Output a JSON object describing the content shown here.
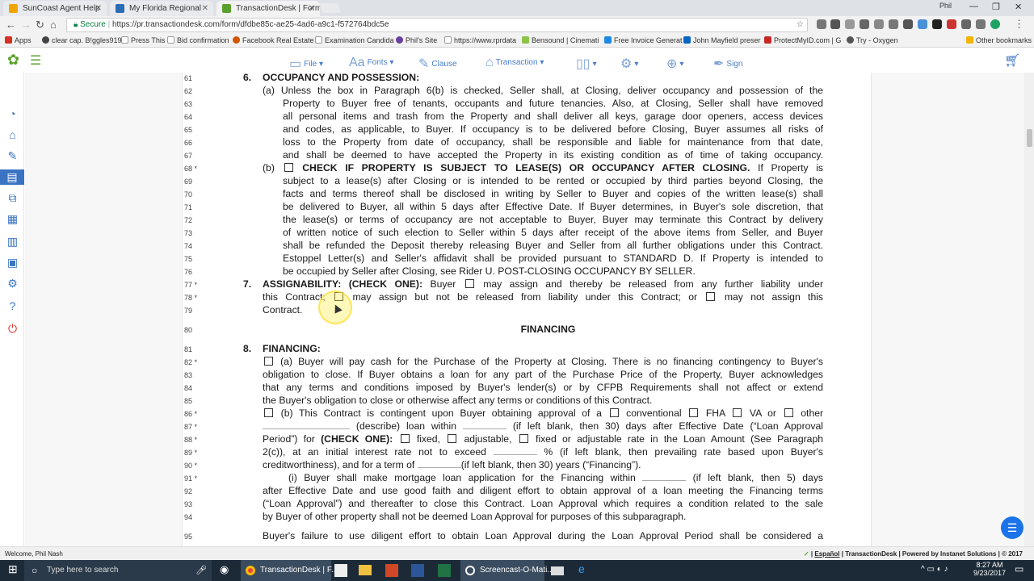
{
  "browser": {
    "tabs": [
      {
        "title": "SunCoast Agent Help"
      },
      {
        "title": "My Florida Regional"
      },
      {
        "title": "TransactionDesk | Forms"
      }
    ],
    "secure_label": "Secure",
    "url": "https://pr.transactiondesk.com/form/dfdbe85c-ae25-4ad6-a9c1-f572764bdc5e",
    "user_badge": "Phil",
    "bookmarks": [
      "Apps",
      "clear cap. B!ggles919",
      "Press This",
      "Bid confirmation",
      "Facebook Real Estate",
      "Examination Candida",
      "Phil's Site",
      "https://www.rprdata",
      "Bensound | Cinemati",
      "Free Invoice Generat",
      "John Mayfield preser",
      "ProtectMyID.com | G",
      "Try - Oxygen",
      "Other bookmarks"
    ]
  },
  "toolbar": {
    "file": "File",
    "fonts": "Fonts",
    "clause": "Clause",
    "transaction": "Transaction",
    "sign": "Sign"
  },
  "document": {
    "lines": {
      "l61": {
        "num": "61",
        "text": "OCCUPANCY AND POSSESSION:"
      },
      "l62": {
        "num": "62",
        "text": "(a)  Unless the box in Paragraph 6(b) is checked, Seller shall, at Closing, deliver occupancy and possession of the"
      },
      "l63": {
        "num": "63",
        "text": "Property to Buyer free of tenants, occupants and future tenancies. Also, at Closing, Seller shall have removed"
      },
      "l64": {
        "num": "64",
        "text": "all personal items and trash from the Property and shall deliver all keys, garage door openers, access devices"
      },
      "l65": {
        "num": "65",
        "text": "and codes, as applicable, to Buyer. If occupancy is to be delivered before Closing, Buyer assumes all risks of"
      },
      "l66": {
        "num": "66",
        "text": "loss to the Property from date of occupancy, shall be responsible and liable for maintenance from that date,"
      },
      "l67": {
        "num": "67",
        "text": "and shall be deemed to have accepted the Property in its existing condition as of time of taking occupancy."
      },
      "l68": {
        "num": "68 *",
        "pre": "(b)",
        "bold": "CHECK IF PROPERTY IS SUBJECT TO LEASE(S) OR OCCUPANCY AFTER CLOSING.",
        "post": "If Property is"
      },
      "l69": {
        "num": "69",
        "text": "subject to a lease(s) after Closing or is intended to be rented or occupied by third parties beyond Closing, the"
      },
      "l70": {
        "num": "70",
        "text": "facts and terms thereof shall be disclosed in writing by Seller to Buyer and copies of the written lease(s) shall"
      },
      "l71": {
        "num": "71",
        "text": "be delivered to Buyer, all within 5 days after Effective Date. If Buyer determines, in Buyer's sole discretion, that"
      },
      "l72": {
        "num": "72",
        "text": "the lease(s) or terms of occupancy are not acceptable to Buyer, Buyer may terminate this Contract by delivery"
      },
      "l73": {
        "num": "73",
        "text": "of written notice of such election to Seller within 5 days after receipt of the above items from Seller, and Buyer"
      },
      "l74": {
        "num": "74",
        "text": "shall be refunded the Deposit thereby releasing Buyer and Seller from all further obligations under this Contract."
      },
      "l75": {
        "num": "75",
        "text": "Estoppel Letter(s) and Seller's affidavit shall be provided pursuant to STANDARD D. If Property is intended to"
      },
      "l76": {
        "num": "76",
        "text": "be occupied by Seller after Closing, see Rider U. POST-CLOSING OCCUPANCY BY SELLER."
      },
      "l77": {
        "num": "77 *",
        "bold": "ASSIGNABILITY: (CHECK ONE):",
        "a": "Buyer",
        "b": "may assign and thereby be released from any further liability under"
      },
      "l78": {
        "num": "78 *",
        "a": "this Contract;",
        "b": "may assign but not be released from liability under this Contract; or",
        "c": "may not assign this"
      },
      "l79": {
        "num": "79",
        "text": "Contract."
      },
      "l80": {
        "num": "80",
        "text": "FINANCING"
      },
      "l81": {
        "num": "81",
        "text": "FINANCING:"
      },
      "l82": {
        "num": "82 *",
        "text": "(a) Buyer will pay cash for the Purchase of the Property at Closing. There is no financing contingency to Buyer's"
      },
      "l83": {
        "num": "83",
        "text": "obligation to close. If Buyer obtains a loan for any part of the Purchase Price of the Property, Buyer acknowledges"
      },
      "l84": {
        "num": "84",
        "text": "that any terms and conditions imposed by Buyer's lender(s) or by CFPB Requirements shall not affect or extend"
      },
      "l85": {
        "num": "85",
        "text": "the Buyer's obligation to close or otherwise affect any terms or conditions of this Contract."
      },
      "l86": {
        "num": "86 *",
        "a": "(b) This Contract is contingent upon Buyer obtaining approval of a",
        "b": "conventional",
        "c": "FHA",
        "d": "VA or",
        "e": "other"
      },
      "l87": {
        "num": "87 *",
        "a": "(describe) loan within",
        "b": "(if left blank, then 30) days after Effective Date (“Loan Approval"
      },
      "l88": {
        "num": "88 *",
        "a": "Period”) for",
        "bold": "(CHECK ONE):",
        "b": "fixed,",
        "c": "adjustable,",
        "d": "fixed or adjustable rate in the Loan Amount (See Paragraph"
      },
      "l89": {
        "num": "89 *",
        "a": "2(c)), at an initial interest rate not to exceed",
        "b": "% (if left blank, then prevailing rate based upon Buyer's"
      },
      "l90": {
        "num": "90 *",
        "a": "creditworthiness), and for a term of",
        "b": "(if left blank, then 30) years (“Financing”)."
      },
      "l91": {
        "num": "91 *",
        "a": "(i) Buyer shall make mortgage loan application for the Financing within",
        "b": "(if left blank, then 5) days"
      },
      "l92": {
        "num": "92",
        "text": "after Effective Date and use good faith and diligent effort to obtain approval of a loan meeting the Financing terms"
      },
      "l93": {
        "num": "93",
        "text": "(“Loan Approval”) and thereafter to close this Contract. Loan Approval which requires a condition related to the sale"
      },
      "l94": {
        "num": "94",
        "text": "by Buyer of other property shall not be deemed Loan Approval for purposes of this subparagraph."
      },
      "l95": {
        "num": "95",
        "text": "Buyer's failure to use diligent effort to obtain Loan Approval during the Loan Approval Period shall be considered a"
      }
    },
    "para6": "6.",
    "para7": "7.",
    "para8": "8."
  },
  "status": {
    "welcome": "Welcome, Phil Nash",
    "language": "Español",
    "brand": "TransactionDesk",
    "powered": "Powered by Instanet Solutions",
    "copyright": "© 2017"
  },
  "taskbar": {
    "search_placeholder": "Type here to search",
    "app1": "TransactionDesk | F...",
    "app2": "Screencast-O-Mati...",
    "time": "8:27 AM",
    "date": "9/23/2017"
  },
  "colors": {
    "accent": "#3a73c2",
    "secure": "#0b8043",
    "taskbar": "#1c2a38"
  }
}
